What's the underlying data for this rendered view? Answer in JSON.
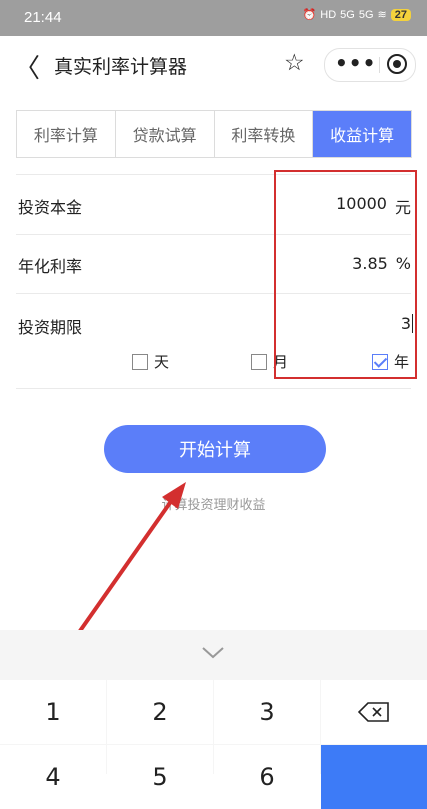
{
  "status_bar": {
    "time": "21:44",
    "hd": "HD",
    "sig1": "5G",
    "sig2": "5G",
    "battery": "27"
  },
  "nav": {
    "title": "真实利率计算器"
  },
  "tabs": [
    {
      "label": "利率计算",
      "active": false
    },
    {
      "label": "贷款试算",
      "active": false
    },
    {
      "label": "利率转换",
      "active": false
    },
    {
      "label": "收益计算",
      "active": true
    }
  ],
  "form": {
    "principal": {
      "label": "投资本金",
      "value": "10000",
      "unit": "元"
    },
    "rate": {
      "label": "年化利率",
      "value": "3.85",
      "unit": "%"
    },
    "period": {
      "label": "投资期限",
      "value": "3"
    },
    "period_units": [
      {
        "label": "天",
        "checked": false
      },
      {
        "label": "月",
        "checked": false
      },
      {
        "label": "年",
        "checked": true
      }
    ]
  },
  "actions": {
    "start_label": "开始计算",
    "sub_text": "计算投资理财收益"
  },
  "keyboard": {
    "row1": [
      "1",
      "2",
      "3"
    ],
    "row2": [
      "4",
      "5",
      "6"
    ],
    "accent_color": "#3d7bf7"
  },
  "colors": {
    "primary": "#5b7ef9",
    "annotation": "#d32f2f"
  }
}
